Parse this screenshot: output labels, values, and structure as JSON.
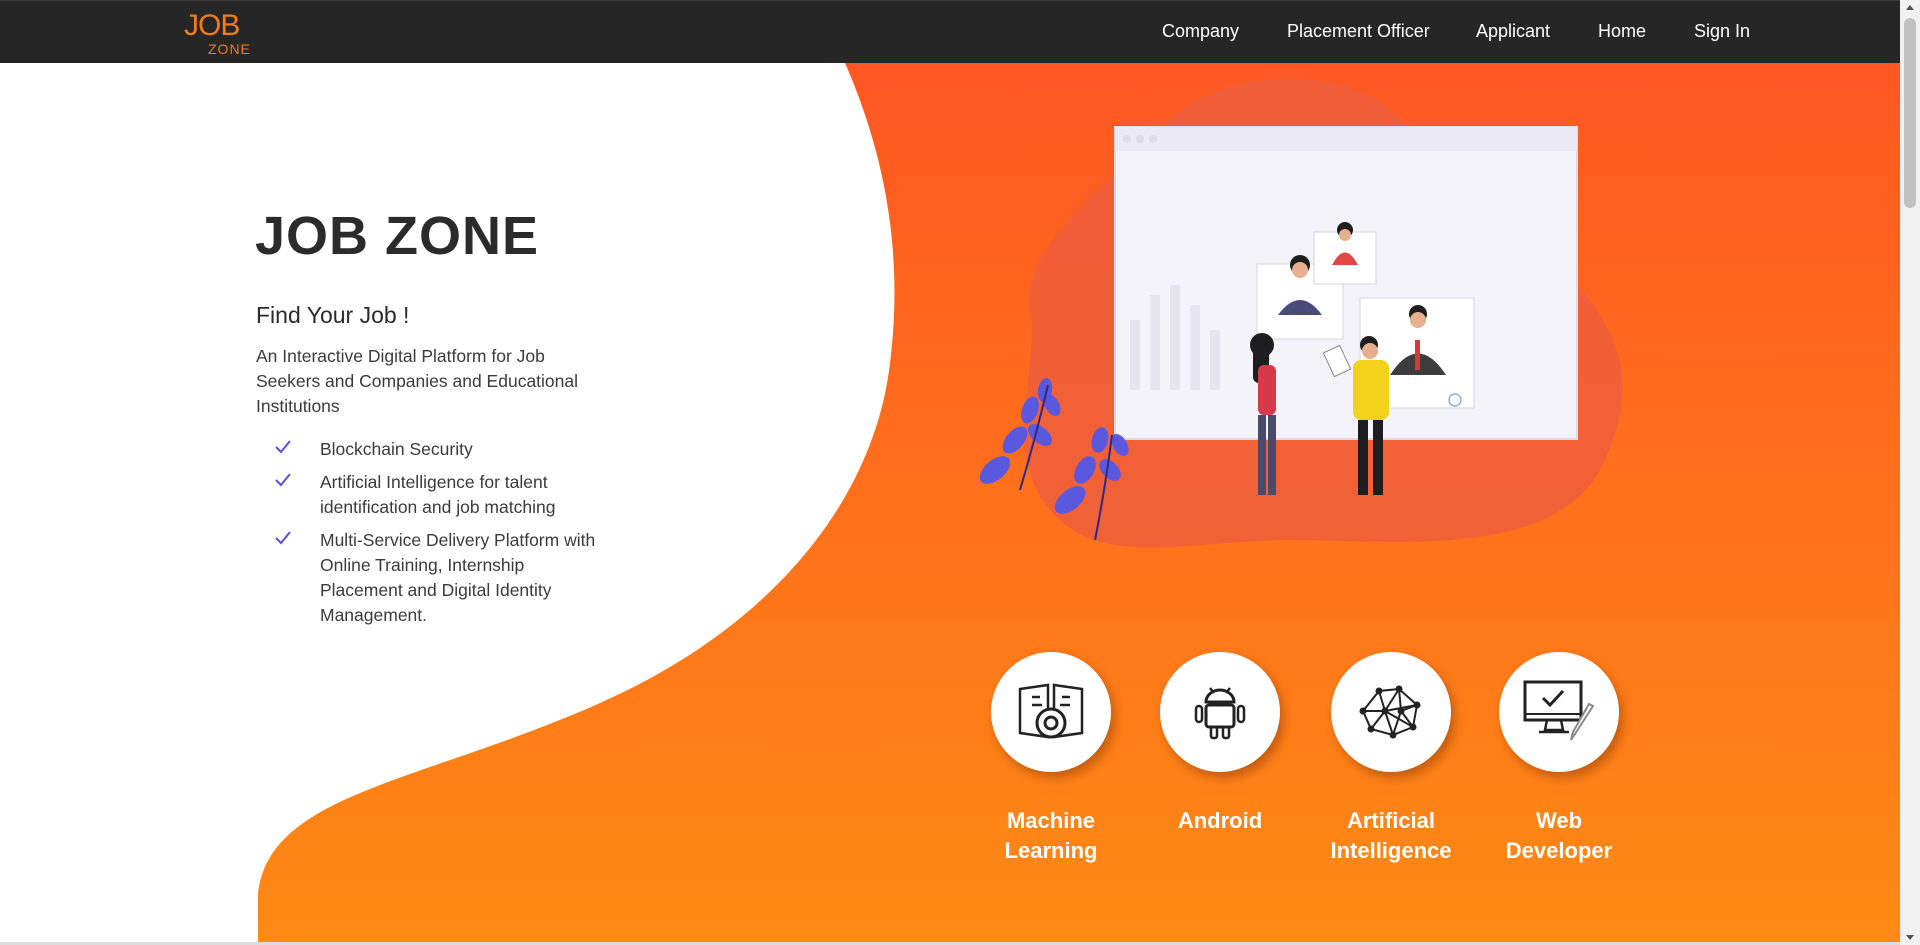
{
  "brand": {
    "logo_top": "JOB",
    "logo_bottom": "ZONE"
  },
  "nav": {
    "items": [
      {
        "label": "Company"
      },
      {
        "label": "Placement Officer"
      },
      {
        "label": "Applicant"
      },
      {
        "label": "Home"
      },
      {
        "label": "Sign In"
      }
    ]
  },
  "hero": {
    "title": "JOB ZONE",
    "subtitle": "Find Your Job !",
    "description": "An Interactive Digital Platform for Job Seekers and Companies and Educational Institutions",
    "features": [
      "Blockchain Security",
      "Artificial Intelligence for talent identification and job matching",
      "Multi-Service Delivery Platform with Online Training, Internship Placement and Digital Identity Management."
    ]
  },
  "categories": [
    {
      "label": "Machine\nLearning",
      "icon": "machine-learning-icon"
    },
    {
      "label": "Android",
      "icon": "android-icon"
    },
    {
      "label": "Artificial\nIntelligence",
      "icon": "neural-network-icon"
    },
    {
      "label": "Web\nDeveloper",
      "icon": "monitor-pen-icon"
    }
  ],
  "colors": {
    "navbar": "#262626",
    "brand_orange": "#f07d1a",
    "hero_orange_top": "#ff5722",
    "hero_orange_bottom": "#ff8a14",
    "check_purple": "#5b4fe0",
    "text_dark": "#2b2b2b"
  }
}
